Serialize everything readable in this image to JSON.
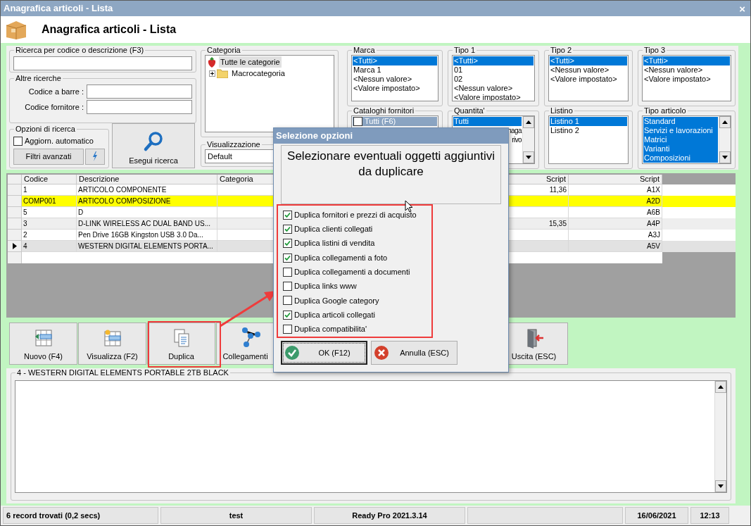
{
  "window": {
    "title": "Anagrafica articoli  - Lista",
    "close": "×"
  },
  "header": {
    "title": "Anagrafica articoli  - Lista"
  },
  "search": {
    "label": "Ricerca per codice o descrizione (F3)"
  },
  "other_searches": {
    "label": "Altre ricerche",
    "fields": [
      {
        "label": "Codice a barre :"
      },
      {
        "label": "Codice fornitore :"
      }
    ]
  },
  "search_options": {
    "label": "Opzioni di ricerca",
    "auto_update": {
      "label": "Aggiorn. automatico",
      "checked": false
    },
    "advanced_button": "Filtri avanzati"
  },
  "run_button": "Esegui ricerca",
  "category": {
    "label": "Categoria",
    "tree": [
      {
        "label": "Tutte le categorie",
        "kind": "root",
        "selected": true
      },
      {
        "label": "Macrocategoria",
        "kind": "folder",
        "selected": false
      }
    ]
  },
  "view": {
    "label": "Visualizzazione",
    "value": "Default"
  },
  "filters": [
    {
      "label": "Marca",
      "items": [
        {
          "label": "<Tutti>",
          "selected": true
        },
        {
          "label": "Marca 1",
          "selected": false
        },
        {
          "label": "<Nessun valore>",
          "selected": false
        },
        {
          "label": "<Valore impostato>",
          "selected": false
        }
      ]
    },
    {
      "label": "Tipo 1",
      "items": [
        {
          "label": "<Tutti>",
          "selected": true
        },
        {
          "label": "01",
          "selected": false
        },
        {
          "label": "02",
          "selected": false
        },
        {
          "label": "<Nessun valore>",
          "selected": false
        },
        {
          "label": "<Valore impostato>",
          "selected": false
        }
      ]
    },
    {
      "label": "Tipo 2",
      "items": [
        {
          "label": "<Tutti>",
          "selected": true
        },
        {
          "label": "<Nessun valore>",
          "selected": false
        },
        {
          "label": "<Valore impostato>",
          "selected": false
        }
      ]
    },
    {
      "label": "Tipo 3",
      "items": [
        {
          "label": "<Tutti>",
          "selected": true
        },
        {
          "label": "<Nessun valore>",
          "selected": false
        },
        {
          "label": "<Valore impostato>",
          "selected": false
        }
      ]
    },
    {
      "label": "Cataloghi fornitori",
      "items": [
        {
          "label": "Tutti (F6)",
          "selected": true,
          "checked": false
        }
      ]
    },
    {
      "label": "Quantita'",
      "scrollbar": true,
      "items": [
        {
          "label": "Tutti",
          "selected": true
        },
        {
          "label": "naga",
          "selected": false,
          "cut": true
        },
        {
          "label": "rivo",
          "selected": false,
          "cut": true
        }
      ]
    },
    {
      "label": "Listino",
      "items": [
        {
          "label": "Listino 1",
          "selected": true
        },
        {
          "label": "Listino 2",
          "selected": false
        }
      ]
    },
    {
      "label": "Tipo articolo",
      "scrollbar": true,
      "items": [
        {
          "label": "Standard",
          "selected": true
        },
        {
          "label": "Servizi e lavorazioni",
          "selected": true
        },
        {
          "label": "Matrici",
          "selected": true
        },
        {
          "label": "Varianti",
          "selected": true
        },
        {
          "label": "Composizioni",
          "selected": true
        }
      ]
    }
  ],
  "table": {
    "columns": [
      "Codice",
      "Descrizione",
      "Categoria",
      "Script",
      "Script"
    ],
    "rows": [
      {
        "cells": [
          "1",
          "ARTICOLO COMPONENTE",
          "",
          "11,36",
          "A1X"
        ],
        "highlighted": false,
        "current": false
      },
      {
        "cells": [
          "COMP001",
          "ARTICOLO COMPOSIZIONE",
          "",
          "",
          "A2D"
        ],
        "highlighted": true,
        "current": false
      },
      {
        "cells": [
          "5",
          "D",
          "",
          "",
          "A6B"
        ],
        "highlighted": false,
        "current": false
      },
      {
        "cells": [
          "3",
          "D-LINK WIRELESS AC DUAL BAND US...",
          "",
          "15,35",
          "A4P"
        ],
        "highlighted": false,
        "current": false
      },
      {
        "cells": [
          "2",
          "Pen Drive 16GB  Kingston  USB 3.0 Da...",
          "",
          "",
          "A3J"
        ],
        "highlighted": false,
        "current": false
      },
      {
        "cells": [
          "4",
          "WESTERN DIGITAL ELEMENTS PORTA...",
          "",
          "",
          "A5V"
        ],
        "highlighted": false,
        "current": true
      }
    ]
  },
  "toolbar": [
    {
      "label": "Nuovo (F4)",
      "kind": "new"
    },
    {
      "label": "Visualizza (F2)",
      "kind": "view"
    },
    {
      "label": "Duplica",
      "kind": "duplicate"
    },
    {
      "label": "Collegamenti",
      "kind": "links"
    },
    {
      "label": "Uscita (ESC)",
      "kind": "exit"
    }
  ],
  "memo": {
    "title": "4 - WESTERN DIGITAL ELEMENTS PORTABLE 2TB BLACK"
  },
  "status_bar": [
    "6 record trovati (0,2 secs)",
    "test",
    "Ready Pro 2021.3.14",
    "16/06/2021",
    "12:13"
  ],
  "dialog": {
    "title": "Selezione opzioni",
    "message": "Selezionare eventuali oggetti aggiuntivi da duplicare",
    "options": [
      {
        "label": "Duplica fornitori e prezzi di acquisto",
        "checked": true
      },
      {
        "label": "Duplica clienti collegati",
        "checked": true
      },
      {
        "label": "Duplica listini di vendita",
        "checked": true
      },
      {
        "label": "Duplica collegamenti a foto",
        "checked": true
      },
      {
        "label": "Duplica collegamenti a documenti",
        "checked": false
      },
      {
        "label": "Duplica links www",
        "checked": false
      },
      {
        "label": "Duplica Google category",
        "checked": false
      },
      {
        "label": "Duplica articoli collegati",
        "checked": true
      },
      {
        "label": "Duplica compatibilita'",
        "checked": false
      }
    ],
    "buttons": [
      {
        "label": "OK (F12)",
        "kind": "ok",
        "focused": true
      },
      {
        "label": "Annulla (ESC)",
        "kind": "cancel",
        "focused": false
      }
    ]
  }
}
